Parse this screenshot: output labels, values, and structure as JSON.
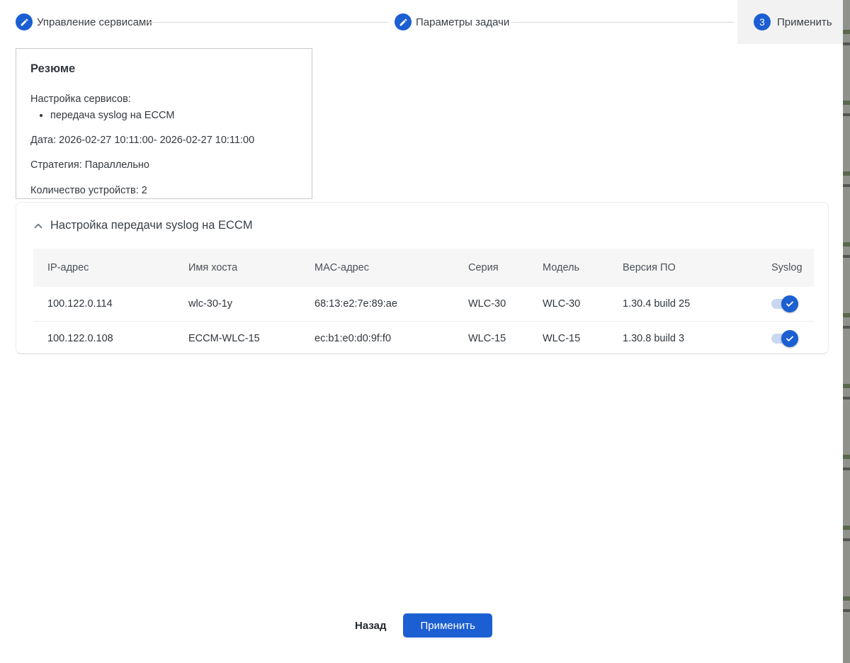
{
  "stepper": {
    "steps": [
      {
        "id": "services",
        "label": "Управление сервисами",
        "icon": "edit-icon",
        "state": "completed"
      },
      {
        "id": "task-params",
        "label": "Параметры задачи",
        "icon": "edit-icon",
        "state": "completed"
      },
      {
        "id": "apply",
        "label": "Применить",
        "number": "3",
        "state": "active"
      }
    ]
  },
  "summary": {
    "title": "Резюме",
    "services_label": "Настройка сервисов:",
    "services": [
      "передача syslog на ECCM"
    ],
    "date_label": "Дата:",
    "date_value": "2026-02-27 10:11:00- 2026-02-27 10:11:00",
    "strategy_label": "Стратегия:",
    "strategy_value": "Параллельно",
    "device_count_label": "Количество устройств:",
    "device_count_value": "2"
  },
  "section": {
    "title": "Настройка передачи syslog на ECCM",
    "table": {
      "headers": [
        "IP-адрес",
        "Имя хоста",
        "MAC-адрес",
        "Серия",
        "Модель",
        "Версия ПО",
        "Syslog"
      ],
      "rows": [
        {
          "ip": "100.122.0.114",
          "hostname": "wlc-30-1y",
          "mac": "68:13:e2:7e:89:ae",
          "series": "WLC-30",
          "model": "WLC-30",
          "firmware": "1.30.4 build 25",
          "syslog_enabled": true
        },
        {
          "ip": "100.122.0.108",
          "hostname": "ECCM-WLC-15",
          "mac": "ec:b1:e0:d0:9f:f0",
          "series": "WLC-15",
          "model": "WLC-15",
          "firmware": "1.30.8 build 3",
          "syslog_enabled": true
        }
      ]
    }
  },
  "footer": {
    "back_label": "Назад",
    "apply_label": "Применить"
  },
  "colors": {
    "primary": "#1c5fd2",
    "active_step_bg": "#f2f2f2",
    "table_header_bg": "#f6f6f7",
    "switch_track": "#c9d7f1"
  }
}
